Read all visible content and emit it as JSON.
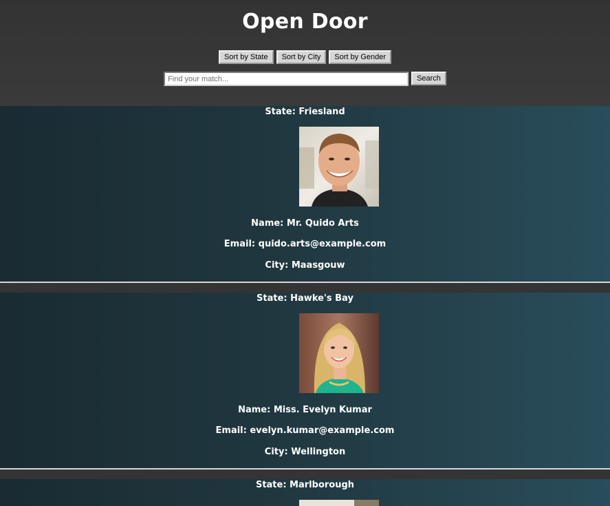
{
  "header": {
    "title": "Open Door",
    "sort_buttons": [
      "Sort by State",
      "Sort by City",
      "Sort by Gender"
    ],
    "search": {
      "placeholder": "Find your match...",
      "value": "",
      "button_label": "Search"
    }
  },
  "profiles": [
    {
      "state": "State: Friesland",
      "name": "Name: Mr. Quido Arts",
      "email": "Email: quido.arts@example.com",
      "city": "City: Maasgouw"
    },
    {
      "state": "State: Hawke's Bay",
      "name": "Name: Miss. Evelyn Kumar",
      "email": "Email: evelyn.kumar@example.com",
      "city": "City: Wellington"
    },
    {
      "state": "State: Marlborough"
    }
  ],
  "colors": {
    "header_bg": "#333333",
    "card_gradient_start": "#1a2b32",
    "card_gradient_end": "#294d5b",
    "text": "#ffffff"
  }
}
